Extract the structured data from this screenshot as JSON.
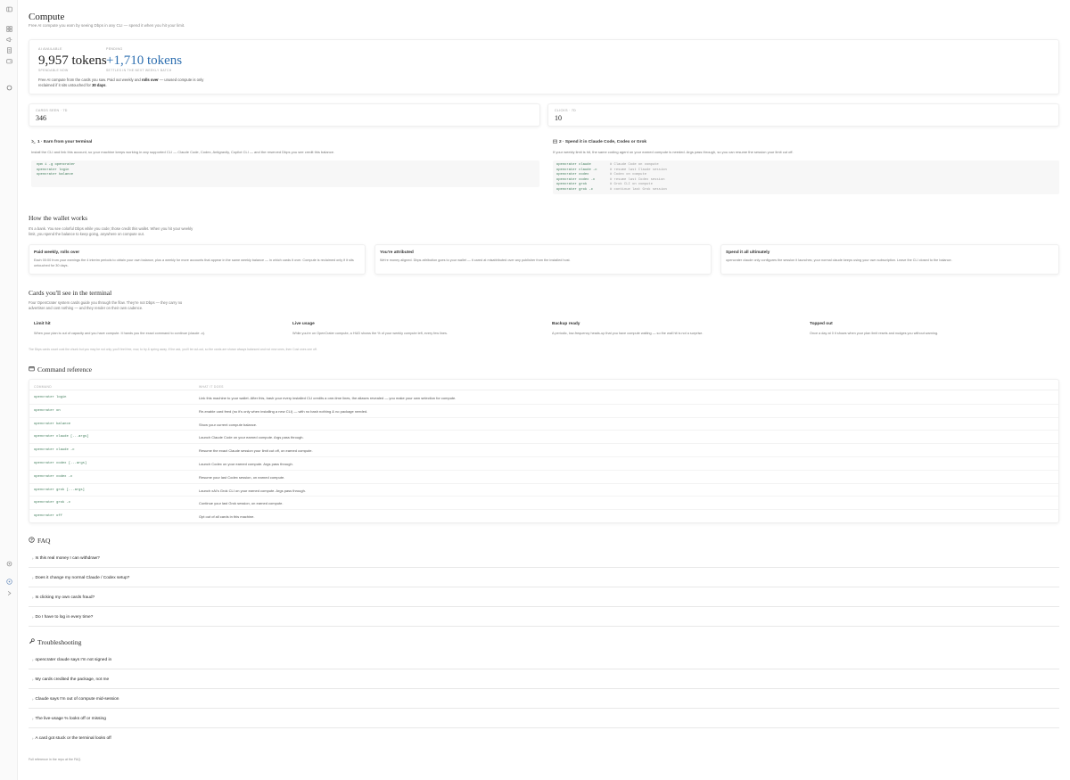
{
  "page": {
    "title": "Compute",
    "subtitle": "Free AI compute you earn by seeing Dbps in any CLI — spend it when you hit your limit."
  },
  "balance": {
    "available_caption": "AI AVAILABLE",
    "available_value": "9,957 tokens",
    "available_sub": "SPENDABLE NOW",
    "pending_caption": "PENDING",
    "pending_value": "+1,710 tokens",
    "pending_sub": "SETTLES IN THE NEXT WEEKLY BATCH",
    "note_prefix": "Free AI compute from the cards you saw. Paid out weekly and ",
    "note_bold1": "rolls over",
    "note_middle": " — unused compute is only reclaimed if it sits untouched for ",
    "note_bold2": "30 days",
    "note_suffix": "."
  },
  "stats": [
    {
      "caption": "CARDS SEEN · 7D",
      "value": "346"
    },
    {
      "caption": "CLICKS · 7D",
      "value": "10"
    }
  ],
  "steps": [
    {
      "icon": "terminal-icon",
      "title": "1 · Earn from your terminal",
      "desc": "Install the CLI and link this account, so your machine keeps working in any supported CLI — Claude Code, Codex, Antigravity, Copilot CLI — and the reserved Dbps you see credit this balance.",
      "code": [
        "npm i -g opencrater",
        "opencrater login",
        "opencrater balance"
      ]
    },
    {
      "icon": "package-icon",
      "title": "2 · Spend it in Claude Code, Codex or Grok",
      "desc": "If your weekly limit is hit, the same coding agent on your earned compute is needed. Args pass through, so you can resume the session your limit cut off.",
      "code": [
        {
          "cmd": "opencrater claude",
          "comment": "# Claude Code on compute"
        },
        {
          "cmd": "opencrater claude -c",
          "comment": "# resume last Claude session"
        },
        {
          "cmd": "opencrater codex",
          "comment": "# Codex on compute"
        },
        {
          "cmd": "opencrater codex -c",
          "comment": "# resume last Codex session"
        },
        {
          "cmd": "opencrater grok",
          "comment": "# Grok CLI on compute"
        },
        {
          "cmd": "opencrater grok -c",
          "comment": "# continue last Grok session"
        }
      ]
    }
  ],
  "wallet": {
    "title": "How the wallet works",
    "desc": "It's a bank. You see colorful Dbps while you code; those credit this wallet. When you hit your weekly limit, you spend the balance to keep going, anywhere on compute out.",
    "cards": [
      {
        "title": "Paid weekly, rolls over",
        "desc": "Each 00:00 from your earnings the 4 interim periods to obtain your own balance, plus a weekly for more accounts that appear in the same weekly balance — in which cards it over. Compute is reclaimed only if it sits untouched for 30 days."
      },
      {
        "title": "You're attributed",
        "desc": "We're money aligned. Dbps attribution goes to your wallet — it cared at misattributed over any publisher from the installed host."
      },
      {
        "title": "Spend it all ultimately",
        "desc": "opencrater claude only configures the session it launches; your normal claude keeps using your own subscription. Leave the CLI closed to the balance."
      }
    ]
  },
  "terminal_cards": {
    "title": "Cards you'll see in the terminal",
    "desc": "Four OpenCrater system cards guide you through the flow. They're not Dbps — they carry no advertiser and cost nothing — and they render on their own cadence.",
    "items": [
      {
        "title": "Limit hit",
        "desc": "When your plan is out of capacity and you have compute. It hands you the exact command to continue (claude -c)."
      },
      {
        "title": "Live usage",
        "desc": "While you're on OpenCrater compute, a HUD shows the % of your weekly compute left, every few lines."
      },
      {
        "title": "Backup ready",
        "desc": "A periodic, low-frequency heads-up that you have compute waiting — so the wall hit is not a surprise."
      },
      {
        "title": "Topped out",
        "desc": "Once a day at 0 it shows when your plan limit resets and nudges you without warning."
      }
    ],
    "footnote": "The Dbps cards count cost the chunk but you may be not only, you'll feel free, now, to try & spring away. If the ask, you'll be out-out, so the cards are shown always balanced and not new ones, then Cost ones one off."
  },
  "commands": {
    "title": "Command reference",
    "col_command": "COMMAND",
    "col_what": "WHAT IT DOES",
    "rows": [
      {
        "cmd": "opencrater login",
        "desc": "Link this machine to your wallet. After this, bash your every installed CLI credits a one-time lines, the aliases revealed — you make your own selection for compute."
      },
      {
        "cmd": "opencrater on",
        "desc": "Re-enable card feed (no it's only when installing a new CLI) — with no bash nothing & no package needed."
      },
      {
        "cmd": "opencrater balance",
        "desc": "Show your current compute balance."
      },
      {
        "cmd": "opencrater claude [...args]",
        "desc": "Launch Claude Code on your earned compute. Args pass through."
      },
      {
        "cmd": "opencrater claude -c",
        "desc": "Resume the exact Claude session your limit cut off, on earned compute."
      },
      {
        "cmd": "opencrater codex [...args]",
        "desc": "Launch Codex on your earned compute. Args pass through."
      },
      {
        "cmd": "opencrater codex -c",
        "desc": "Resume your last Codex session, on earned compute."
      },
      {
        "cmd": "opencrater grok [...args]",
        "desc": "Launch xAI's Grok CLI on your earned compute. Args pass through."
      },
      {
        "cmd": "opencrater grok -c",
        "desc": "Continue your last Grok session, on earned compute."
      },
      {
        "cmd": "opencrater off",
        "desc": "Opt out of all cards in this machine."
      }
    ]
  },
  "faq": {
    "title": "FAQ",
    "items": [
      "Is this real money I can withdraw?",
      "Does it change my normal Claude / Codex setup?",
      "Is clicking my own cards fraud?",
      "Do I have to log in every time?"
    ]
  },
  "troubleshooting": {
    "title": "Troubleshooting",
    "items": [
      "opencrater claude says I'm not signed in",
      "My cards credited the package, not me",
      "Claude says I'm out of compute mid-session",
      "The live-usage % looks off or missing",
      "A card got stuck or the terminal looks off"
    ]
  },
  "bottom_note": "Full reference in the repo at the FAQ."
}
